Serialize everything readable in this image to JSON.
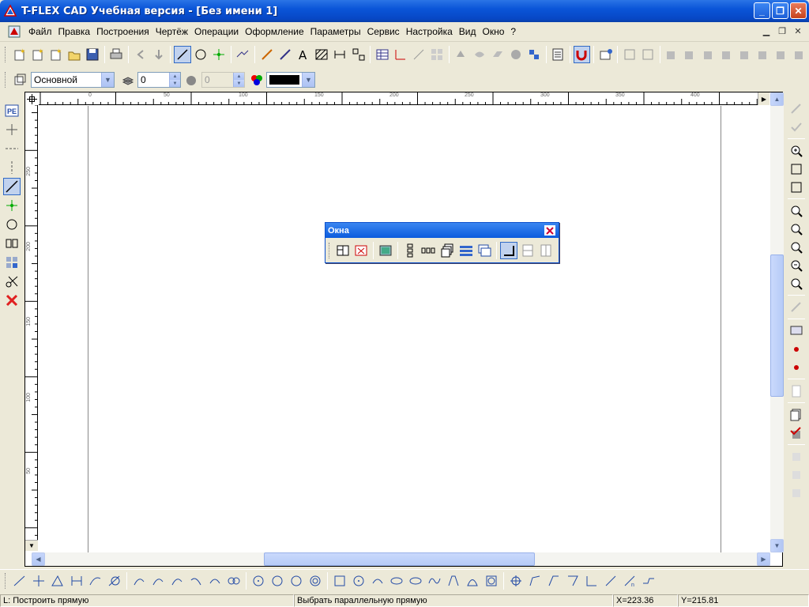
{
  "window": {
    "title": "T-FLEX CAD Учебная версия - [Без имени 1]",
    "minimize_label": "_",
    "maximize_label": "❐",
    "close_label": "✕"
  },
  "menu": {
    "items": [
      "Файл",
      "Правка",
      "Построения",
      "Чертёж",
      "Операции",
      "Оформление",
      "Параметры",
      "Сервис",
      "Настройка",
      "Вид",
      "Окно",
      "?"
    ]
  },
  "properties_bar": {
    "layer_value": "Основной",
    "level_value": "0",
    "priority_value": "0",
    "color_value": "#000000"
  },
  "ruler": {
    "h_ticks": [
      "0",
      "50",
      "100",
      "150",
      "200",
      "250",
      "300",
      "350",
      "400"
    ],
    "v_ticks": [
      "250",
      "200",
      "150",
      "100",
      "50"
    ]
  },
  "float_toolbar": {
    "title": "Окна"
  },
  "status": {
    "command": "L: Построить прямую",
    "prompt": "Выбрать параллельную прямую",
    "x": "X=223.36",
    "y": "Y=215.81"
  },
  "colors": {
    "accent": "#316ac5",
    "titlebar": "#0a55d8",
    "background": "#ece9d8"
  }
}
